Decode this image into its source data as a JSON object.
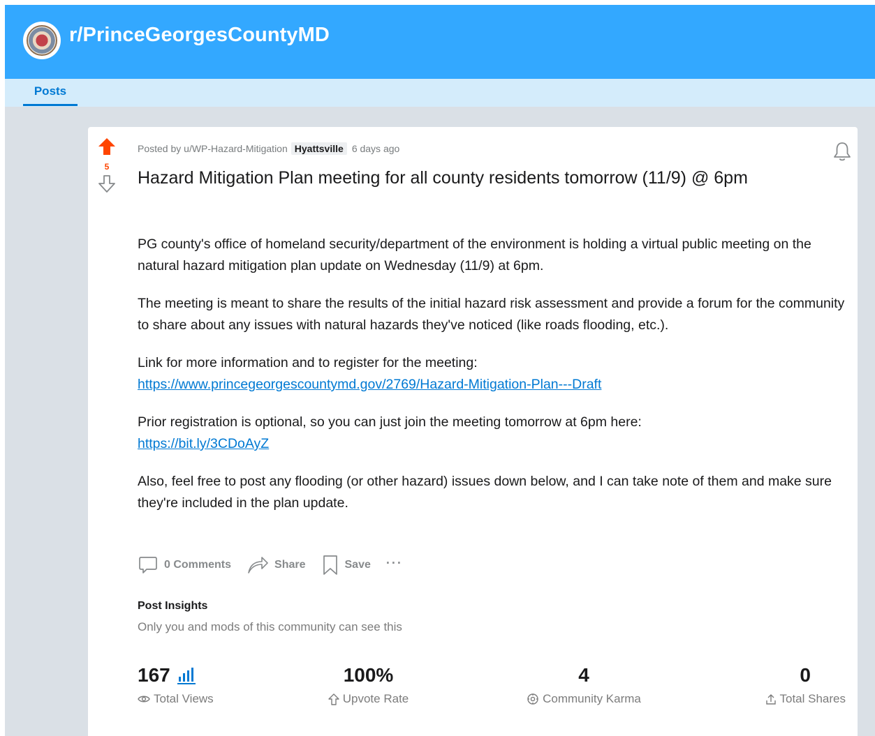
{
  "subreddit": {
    "name": "r/PrinceGeorgesCountyMD",
    "icon": "county-seal-icon",
    "banner_color": "#33a8ff",
    "tab_bar_color": "#d4ecfb"
  },
  "tabs": [
    {
      "label": "Posts",
      "active": true
    }
  ],
  "post": {
    "score": "5",
    "posted_by": "Posted by u/WP-Hazard-Mitigation",
    "flair": "Hyattsville",
    "age": "6 days ago",
    "title": "Hazard Mitigation Plan meeting for all county residents tomorrow (11/9) @ 6pm",
    "paragraphs": {
      "p1": "PG county's office of homeland security/department of the environment is holding a virtual public meeting on the natural hazard mitigation plan update on Wednesday (11/9) at 6pm.",
      "p2": "The meeting is meant to share the results of the initial hazard risk assessment and provide a forum for the community to share about any issues with natural hazards they've noticed (like roads flooding, etc.).",
      "p3_text": "Link for more information and to register for the meeting:",
      "p3_link": "https://www.princegeorgescountymd.gov/2769/Hazard-Mitigation-Plan---Draft",
      "p4_text": "Prior registration is optional, so you can just join the meeting tomorrow at 6pm here:",
      "p4_link": "https://bit.ly/3CDoAyZ",
      "p5": "Also, feel free to post any flooding (or other hazard) issues down below, and I can take note of them and make sure they're included in the plan update."
    },
    "actions": {
      "comments": "0 Comments",
      "share": "Share",
      "save": "Save",
      "more": "···"
    }
  },
  "insights": {
    "title": "Post Insights",
    "subtitle": "Only you and mods of this community can see this",
    "stats": {
      "views": {
        "value": "167",
        "label": "Total Views"
      },
      "upvote_rate": {
        "value": "100%",
        "label": "Upvote Rate"
      },
      "karma": {
        "value": "4",
        "label": "Community Karma"
      },
      "shares": {
        "value": "0",
        "label": "Total Shares"
      }
    }
  },
  "colors": {
    "upvote": "#ff4500",
    "link": "#0079d3",
    "page_background": "#dae0e6"
  }
}
